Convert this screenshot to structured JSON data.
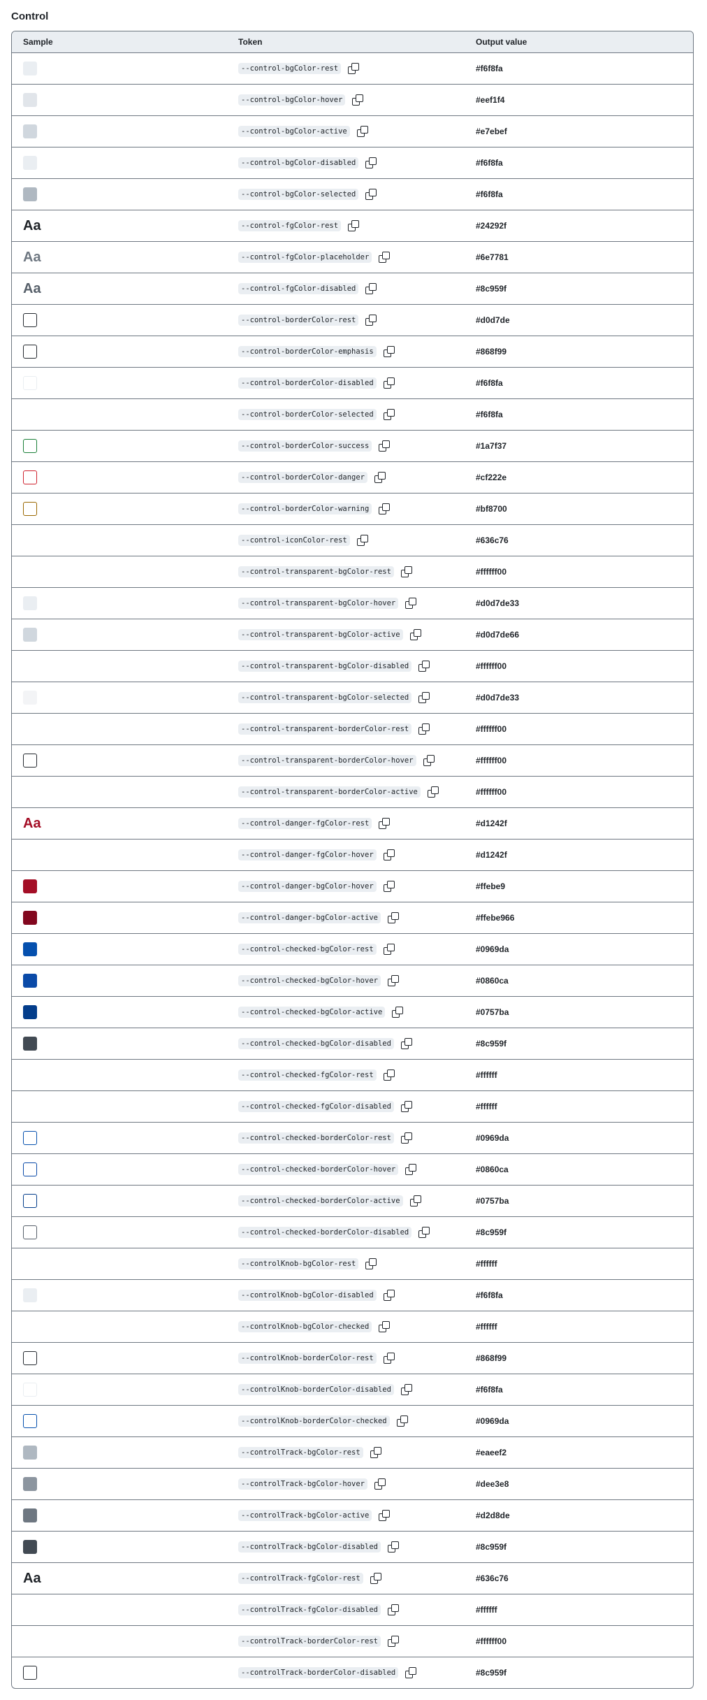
{
  "section": {
    "title": "Control"
  },
  "headers": {
    "sample": "Sample",
    "token": "Token",
    "value": "Output value"
  },
  "rows": [
    {
      "kind": "swatch",
      "fill": "#eaeef2",
      "border": "",
      "token": "--control-bgColor-rest",
      "value": "#f6f8fa"
    },
    {
      "kind": "swatch",
      "fill": "#e1e5ea",
      "border": "",
      "token": "--control-bgColor-hover",
      "value": "#eef1f4"
    },
    {
      "kind": "swatch",
      "fill": "#d0d7de",
      "border": "",
      "token": "--control-bgColor-active",
      "value": "#e7ebef"
    },
    {
      "kind": "swatch",
      "fill": "#eaeef2",
      "border": "",
      "token": "--control-bgColor-disabled",
      "value": "#f6f8fa"
    },
    {
      "kind": "swatch",
      "fill": "#afb8c1",
      "border": "",
      "token": "--control-bgColor-selected",
      "value": "#f6f8fa"
    },
    {
      "kind": "text",
      "color": "#1f2328",
      "sample": "Aa",
      "token": "--control-fgColor-rest",
      "value": "#24292f"
    },
    {
      "kind": "text",
      "color": "#6e7781",
      "sample": "Aa",
      "token": "--control-fgColor-placeholder",
      "value": "#6e7781"
    },
    {
      "kind": "text",
      "color": "#57606a",
      "sample": "Aa",
      "token": "--control-fgColor-disabled",
      "value": "#8c959f"
    },
    {
      "kind": "swatch",
      "fill": "#ffffff",
      "border": "#24292f",
      "token": "--control-borderColor-rest",
      "value": "#d0d7de"
    },
    {
      "kind": "swatch",
      "fill": "#ffffff",
      "border": "#24292f",
      "token": "--control-borderColor-emphasis",
      "value": "#868f99"
    },
    {
      "kind": "swatch",
      "fill": "#ffffff",
      "border": "#eaeef2",
      "token": "--control-borderColor-disabled",
      "value": "#f6f8fa"
    },
    {
      "kind": "none",
      "token": "--control-borderColor-selected",
      "value": "#f6f8fa"
    },
    {
      "kind": "swatch",
      "fill": "#ffffff",
      "border": "#1a7f37",
      "token": "--control-borderColor-success",
      "value": "#1a7f37"
    },
    {
      "kind": "swatch",
      "fill": "#ffffff",
      "border": "#cf222e",
      "token": "--control-borderColor-danger",
      "value": "#cf222e"
    },
    {
      "kind": "swatch",
      "fill": "#ffffff",
      "border": "#9a6700",
      "token": "--control-borderColor-warning",
      "value": "#bf8700"
    },
    {
      "kind": "none",
      "token": "--control-iconColor-rest",
      "value": "#636c76"
    },
    {
      "kind": "none",
      "token": "--control-transparent-bgColor-rest",
      "value": "#ffffff00"
    },
    {
      "kind": "swatch",
      "fill": "#eaeef2",
      "border": "",
      "token": "--control-transparent-bgColor-hover",
      "value": "#d0d7de33"
    },
    {
      "kind": "swatch",
      "fill": "#d0d7de",
      "border": "",
      "token": "--control-transparent-bgColor-active",
      "value": "#d0d7de66"
    },
    {
      "kind": "none",
      "token": "--control-transparent-bgColor-disabled",
      "value": "#ffffff00"
    },
    {
      "kind": "swatch",
      "fill": "#f3f4f6",
      "border": "",
      "token": "--control-transparent-bgColor-selected",
      "value": "#d0d7de33"
    },
    {
      "kind": "none",
      "token": "--control-transparent-borderColor-rest",
      "value": "#ffffff00"
    },
    {
      "kind": "swatch",
      "fill": "#ffffff",
      "border": "#24292f",
      "token": "--control-transparent-borderColor-hover",
      "value": "#ffffff00"
    },
    {
      "kind": "none",
      "token": "--control-transparent-borderColor-active",
      "value": "#ffffff00"
    },
    {
      "kind": "text",
      "color": "#a40e26",
      "sample": "Aa",
      "token": "--control-danger-fgColor-rest",
      "value": "#d1242f"
    },
    {
      "kind": "none",
      "token": "--control-danger-fgColor-hover",
      "value": "#d1242f"
    },
    {
      "kind": "swatch",
      "fill": "#a40e26",
      "border": "",
      "token": "--control-danger-bgColor-hover",
      "value": "#ffebe9"
    },
    {
      "kind": "swatch",
      "fill": "#82071e",
      "border": "",
      "token": "--control-danger-bgColor-active",
      "value": "#ffebe966"
    },
    {
      "kind": "swatch",
      "fill": "#0550ae",
      "border": "",
      "token": "--control-checked-bgColor-rest",
      "value": "#0969da"
    },
    {
      "kind": "swatch",
      "fill": "#0a4aa8",
      "border": "",
      "token": "--control-checked-bgColor-hover",
      "value": "#0860ca"
    },
    {
      "kind": "swatch",
      "fill": "#033d8b",
      "border": "",
      "token": "--control-checked-bgColor-active",
      "value": "#0757ba"
    },
    {
      "kind": "swatch",
      "fill": "#424a53",
      "border": "",
      "token": "--control-checked-bgColor-disabled",
      "value": "#8c959f"
    },
    {
      "kind": "none",
      "token": "--control-checked-fgColor-rest",
      "value": "#ffffff"
    },
    {
      "kind": "none",
      "token": "--control-checked-fgColor-disabled",
      "value": "#ffffff"
    },
    {
      "kind": "swatch",
      "fill": "#ffffff",
      "border": "#0550ae",
      "token": "--control-checked-borderColor-rest",
      "value": "#0969da"
    },
    {
      "kind": "swatch",
      "fill": "#ffffff",
      "border": "#0a4aa8",
      "token": "--control-checked-borderColor-hover",
      "value": "#0860ca"
    },
    {
      "kind": "swatch",
      "fill": "#ffffff",
      "border": "#033d8b",
      "token": "--control-checked-borderColor-active",
      "value": "#0757ba"
    },
    {
      "kind": "swatch",
      "fill": "#ffffff",
      "border": "#57606a",
      "token": "--control-checked-borderColor-disabled",
      "value": "#8c959f"
    },
    {
      "kind": "none",
      "token": "--controlKnob-bgColor-rest",
      "value": "#ffffff"
    },
    {
      "kind": "swatch",
      "fill": "#eaeef2",
      "border": "",
      "token": "--controlKnob-bgColor-disabled",
      "value": "#f6f8fa"
    },
    {
      "kind": "none",
      "token": "--controlKnob-bgColor-checked",
      "value": "#ffffff"
    },
    {
      "kind": "swatch",
      "fill": "#ffffff",
      "border": "#24292f",
      "token": "--controlKnob-borderColor-rest",
      "value": "#868f99"
    },
    {
      "kind": "swatch",
      "fill": "#ffffff",
      "border": "#eaeef2",
      "token": "--controlKnob-borderColor-disabled",
      "value": "#f6f8fa"
    },
    {
      "kind": "swatch",
      "fill": "#ffffff",
      "border": "#0550ae",
      "token": "--controlKnob-borderColor-checked",
      "value": "#0969da"
    },
    {
      "kind": "swatch",
      "fill": "#afb8c1",
      "border": "",
      "token": "--controlTrack-bgColor-rest",
      "value": "#eaeef2"
    },
    {
      "kind": "swatch",
      "fill": "#8c959f",
      "border": "",
      "token": "--controlTrack-bgColor-hover",
      "value": "#dee3e8"
    },
    {
      "kind": "swatch",
      "fill": "#6e7781",
      "border": "",
      "token": "--controlTrack-bgColor-active",
      "value": "#d2d8de"
    },
    {
      "kind": "swatch",
      "fill": "#424a53",
      "border": "",
      "token": "--controlTrack-bgColor-disabled",
      "value": "#8c959f"
    },
    {
      "kind": "text",
      "color": "#1f2328",
      "sample": "Aa",
      "token": "--controlTrack-fgColor-rest",
      "value": "#636c76"
    },
    {
      "kind": "none",
      "token": "--controlTrack-fgColor-disabled",
      "value": "#ffffff"
    },
    {
      "kind": "none",
      "token": "--controlTrack-borderColor-rest",
      "value": "#ffffff00"
    },
    {
      "kind": "swatch",
      "fill": "#ffffff",
      "border": "#24292f",
      "token": "--controlTrack-borderColor-disabled",
      "value": "#8c959f"
    }
  ]
}
